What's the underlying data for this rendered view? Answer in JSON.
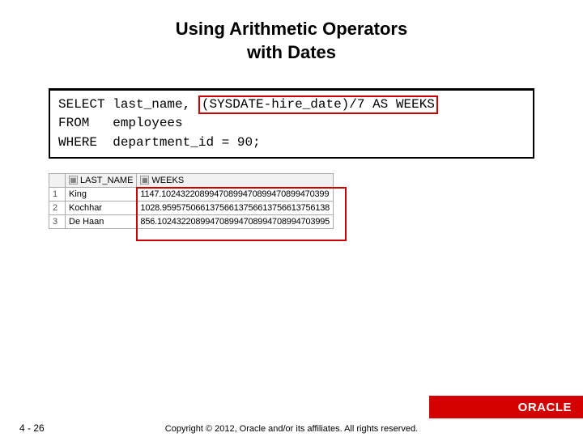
{
  "title_line1": "Using Arithmetic Operators",
  "title_line2": "with Dates",
  "sql": {
    "kw_select": "SELECT",
    "col1": "last_name,",
    "highlighted": "(SYSDATE-hire_date)/7 AS WEEKS",
    "kw_from": "FROM",
    "tbl": "employees",
    "kw_where": "WHERE",
    "cond": "department_id = 90;"
  },
  "table": {
    "headers": {
      "c1": "LAST_NAME",
      "c2": "WEEKS"
    },
    "rows": [
      {
        "n": "1",
        "last_name": "King",
        "weeks": "1147.10243220899470899470899470899470399"
      },
      {
        "n": "2",
        "last_name": "Kochhar",
        "weeks": "1028.95957506613756613756613756613756138"
      },
      {
        "n": "3",
        "last_name": "De Haan",
        "weeks": "856.102432208994708994708994708994703995"
      }
    ]
  },
  "logo": "ORACLE",
  "page": "4 - 26",
  "copyright": "Copyright © 2012, Oracle and/or its affiliates. All rights reserved."
}
